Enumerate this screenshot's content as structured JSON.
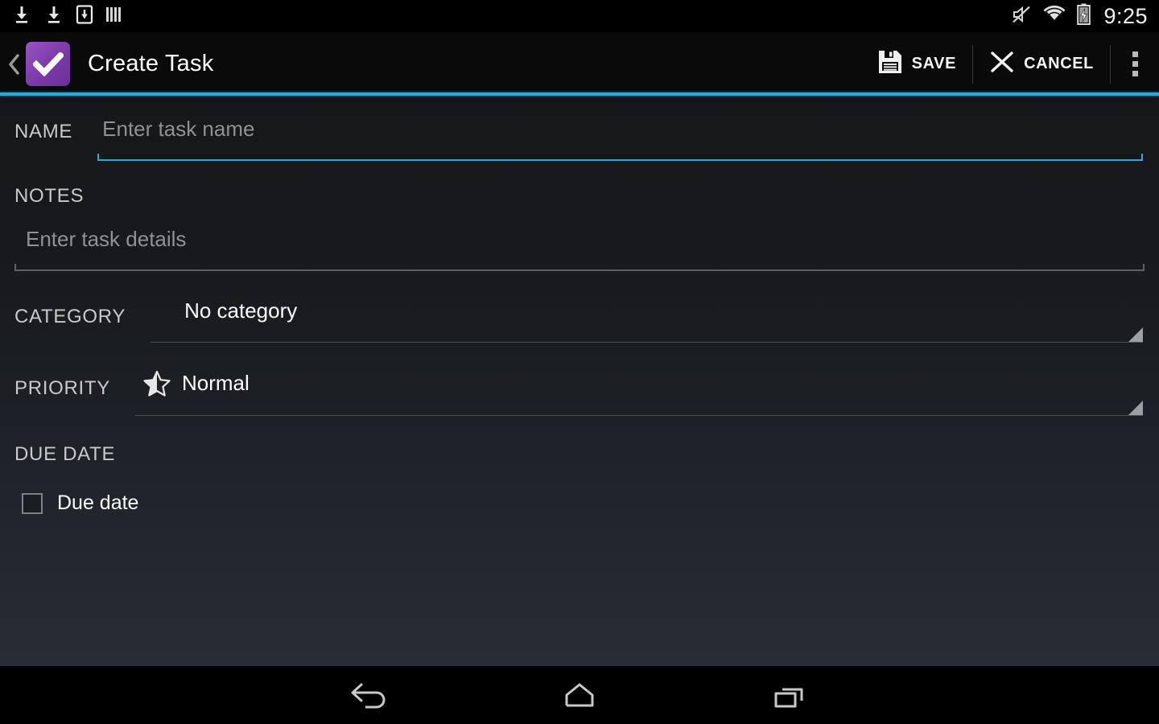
{
  "status_bar": {
    "notification_icons": [
      "download-arrow-icon",
      "download-arrow-icon",
      "download-box-icon",
      "barcode-icon"
    ],
    "system_icons": [
      "volume-mute-icon",
      "wifi-icon",
      "battery-charging-icon"
    ],
    "time": "9:25"
  },
  "action_bar": {
    "up_icon": "back-chevron-icon",
    "app_icon": "checkmark-app-icon",
    "title": "Create Task",
    "save_label": "SAVE",
    "save_icon": "floppy-disk-icon",
    "cancel_label": "CANCEL",
    "cancel_icon": "close-x-icon",
    "overflow_icon": "overflow-menu-icon",
    "accent_color": "#33b5e5"
  },
  "form": {
    "name": {
      "label": "NAME",
      "placeholder": "Enter task name",
      "value": "",
      "focused": true
    },
    "notes": {
      "label": "NOTES",
      "placeholder": "Enter task details",
      "value": "",
      "focused": false
    },
    "category": {
      "label": "CATEGORY",
      "selected": "No category",
      "caret_icon": "spinner-caret-icon"
    },
    "priority": {
      "label": "PRIORITY",
      "selected": "Normal",
      "icon": "half-star-icon",
      "caret_icon": "spinner-caret-icon"
    },
    "due_date": {
      "label": "DUE DATE",
      "checkbox_label": "Due date",
      "checked": false
    }
  },
  "nav_bar": {
    "back": "back-nav-icon",
    "home": "home-nav-icon",
    "recents": "recents-nav-icon"
  },
  "colors": {
    "accent": "#33b5e5",
    "app_purple": "#8246bb",
    "bg_top": "#141618",
    "bg_bottom": "#2a2f39"
  }
}
